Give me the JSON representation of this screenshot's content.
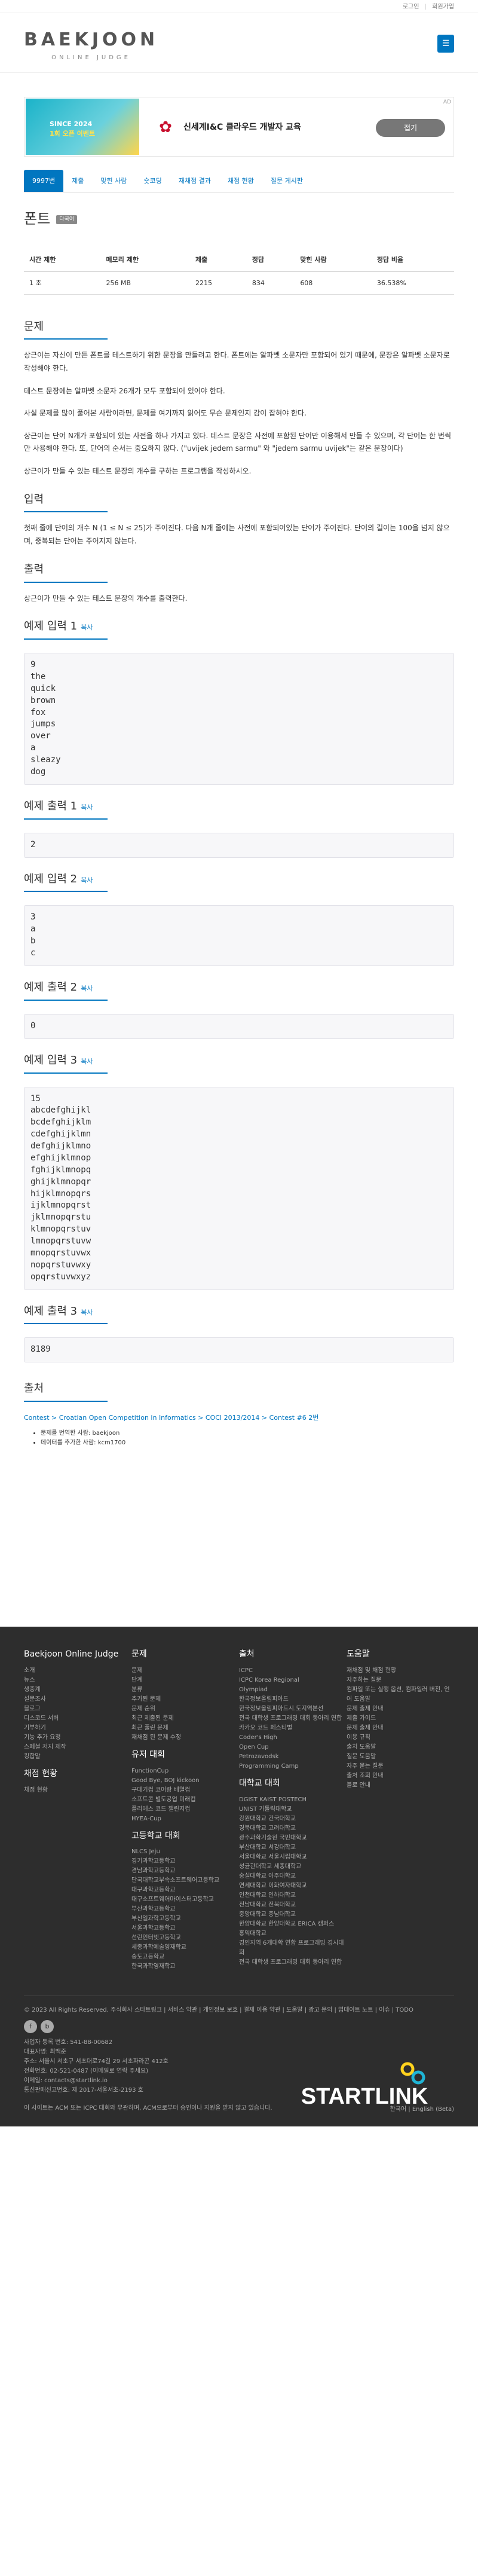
{
  "top": {
    "login": "로그인",
    "signup": "회원가입"
  },
  "logo": {
    "name": "BAEKJOON",
    "sub": "ONLINE JUDGE"
  },
  "ad": {
    "banner_line1": "SINCE 2024",
    "banner_line2": "1회 오픈 이벤트",
    "text": "신세계I&C 클라우드 개발자 교육",
    "button": "접기",
    "close": "AD"
  },
  "tabs": [
    "9997번",
    "제출",
    "맞힌 사람",
    "숏코딩",
    "재채점 결과",
    "채점 현황",
    "질문 게시판"
  ],
  "problem": {
    "title": "폰트",
    "tag": "다국어",
    "table_headers": [
      "시간 제한",
      "메모리 제한",
      "제출",
      "정답",
      "맞힌 사람",
      "정답 비율"
    ],
    "table_row": [
      "1 초",
      "256 MB",
      "2215",
      "834",
      "608",
      "36.538%"
    ]
  },
  "sections": {
    "problem": "문제",
    "input": "입력",
    "output": "출력",
    "source": "출처",
    "copy": "복사"
  },
  "problem_text": [
    "상근이는 자신이 만든 폰트를 테스트하기 위한 문장을 만들려고 한다. 폰트에는 알파벳 소문자만 포함되어 있기 때문에, 문장은 알파벳 소문자로 작성해야 한다.",
    "테스트 문장에는 알파벳 소문자 26개가 모두 포함되어 있어야 한다.",
    "사실 문제를 많이 풀어본 사람이라면, 문제를 여기까지 읽어도 무슨 문제인지 감이 잡혀야 한다.",
    "상근이는 단어 N개가 포함되어 있는 사전을 하나 가지고 있다. 테스트 문장은 사전에 포함된 단어만 이용해서 만들 수 있으며, 각 단어는 한 번씩만 사용해야 한다. 또, 단어의 순서는 중요하지 않다. (\"uvijek jedem sarmu\" 와 \"jedem sarmu uvijek\"는 같은 문장이다)",
    "상근이가 만들 수 있는 테스트 문장의 개수를 구하는 프로그램을 작성하시오."
  ],
  "input_text": "첫째 줄에 단어의 개수 N (1 ≤ N ≤ 25)가 주어진다. 다음 N개 줄에는 사전에 포함되어있는 단어가 주어진다. 단어의 길이는 100을 넘지 않으며, 중복되는 단어는 주어지지 않는다.",
  "output_text": "상근이가 만들 수 있는 테스트 문장의 개수를 출력한다.",
  "examples": [
    {
      "in_title": "예제 입력 1",
      "in": "9\nthe\nquick\nbrown\nfox\njumps\nover\na\nsleazy\ndog",
      "out_title": "예제 출력 1",
      "out": "2"
    },
    {
      "in_title": "예제 입력 2",
      "in": "3\na\nb\nc",
      "out_title": "예제 출력 2",
      "out": "0"
    },
    {
      "in_title": "예제 입력 3",
      "in": "15\nabcdefghijkl\nbcdefghijklm\ncdefghijklmn\ndefghijklmno\nefghijklmnop\nfghijklmnopq\nghijklmnopqr\nhijklmnopqrs\nijklmnopqrst\njklmnopqrstu\nklmnopqrstuv\nlmnopqrstuvw\nmnopqrstuvwx\nnopqrstuvwxy\nopqrstuvwxyz",
      "out_title": "예제 출력 3",
      "out": "8189"
    }
  ],
  "source": {
    "link": "Contest > Croatian Open Competition in Informatics > COCI 2013/2014 > Contest #6 2번",
    "items": [
      "문제를 번역한 사람: baekjoon",
      "데이터를 추가한 사람: kcm1700"
    ]
  },
  "footer": {
    "cols": [
      {
        "title": "Baekjoon Online Judge",
        "items": [
          "소개",
          "뉴스",
          "생중계",
          "설문조사",
          "블로그",
          "디스코드 서버",
          "기부하기",
          "기능 추가 요청",
          "스페셜 저지 제작",
          "킹합말"
        ],
        "title2": "채점 현황",
        "items2": [
          "채점 현황"
        ]
      },
      {
        "title": "문제",
        "items": [
          "문제",
          "단계",
          "분류",
          "추가된 문제",
          "문제 순위",
          "최근 제출된 문제",
          "최근 풀린 문제",
          "재채점 된 문제 수정"
        ],
        "title2": "유저 대회",
        "items2": [
          "FunctionCup",
          "Good Bye, BOJ kickoon",
          "구데기컵 코어랑 배열컵",
          "소프트콘 별도공업 미래컵",
          "플리에스 코드 챌린지컵",
          "HYEA-Cup"
        ],
        "title3": "고등학교 대회",
        "items3": [
          "NLCS Jeju",
          "경기과학고등학교",
          "경남과학고등학교",
          "단국대학교부속소프트웨어고등학교",
          "대구과학고등학교",
          "대구소프트웨어마이스터고등학교",
          "부산과학고등학교",
          "부산일과학고등학교",
          "서울과학고등학교",
          "선린인터넷고등학교",
          "세종과학예술영재학교",
          "숭도고등학교",
          "한국과학영재학교"
        ]
      },
      {
        "title": "출처",
        "items": [
          "ICPC",
          "ICPC Korea Regional",
          "Olympiad",
          "한국정보올림피아드",
          "한국정보올림피아드시.도지역본선",
          "전국 대학생 프로그래밍 대회 동아리 연합",
          "카카오 코드 페스티벌",
          "Coder's High",
          "Open Cup",
          "Petrozavodsk",
          "Programming Camp"
        ],
        "title2": "대학교 대회",
        "items2": [
          "DGIST KAIST POSTECH",
          "UNIST 가톨릭대학교",
          "강원대학교 건국대학교",
          "경북대학교 고려대학교",
          "광주과학기술원 국민대학교",
          "부산대학교 서강대학교",
          "서울대학교 서울시립대학교",
          "성균관대학교 세종대학교",
          "숭실대학교 아주대학교",
          "연세대학교 이화여자대학교",
          "인천대학교 인하대학교",
          "전남대학교 전북대학교",
          "중앙대학교 충남대학교",
          "한양대학교 한양대학교 ERICA 캠퍼스",
          "홍익대학교",
          "경인지역 6개대학 연합 프로그래밍 경시대회",
          "전국 대학생 프로그래밍 대회 동아리 연합"
        ]
      },
      {
        "title": "도움말",
        "items": [
          "재채점 및 채점 현황",
          "자주하는 질문",
          "컴파일 또는 실행 옵션, 컴파일러 버전, 언어 도움말",
          "문제 출제 안내",
          "제출 가이드",
          "문제 출제 안내",
          "이용 규칙",
          "출처 도움말",
          "질문 도움말",
          "자주 묻는 질문",
          "출처 조회 안내",
          "블로 안내"
        ]
      }
    ],
    "copyright": "© 2023 All Rights Reserved. 주식회사 스타트링크 | 서비스 약관 | 개인정보 보호 | 결제 이용 약관 | 도움말 | 광고 문의 | 업데이트 노트 | 이슈 | TODO",
    "company": [
      "사업자 등록 번호: 541-88-00682",
      "대표자명: 최백준",
      "주소: 서울시 서초구 서초대로74길 29 서초파라곤 412호",
      "전화번호: 02-521-0487 (이메일로 연락 주세요)",
      "이메일: contacts@startlink.io",
      "통신판매신고번호: 제 2017-서울서초-2193 호"
    ],
    "notice": "이 사이트는 ACM 또는 ICPC 대회와 무관하며, ACM으로부터 승인이나 지원을 받지 않고 있습니다.",
    "lang": "한국어 | English (Beta)",
    "brand": "STARTLINK"
  }
}
